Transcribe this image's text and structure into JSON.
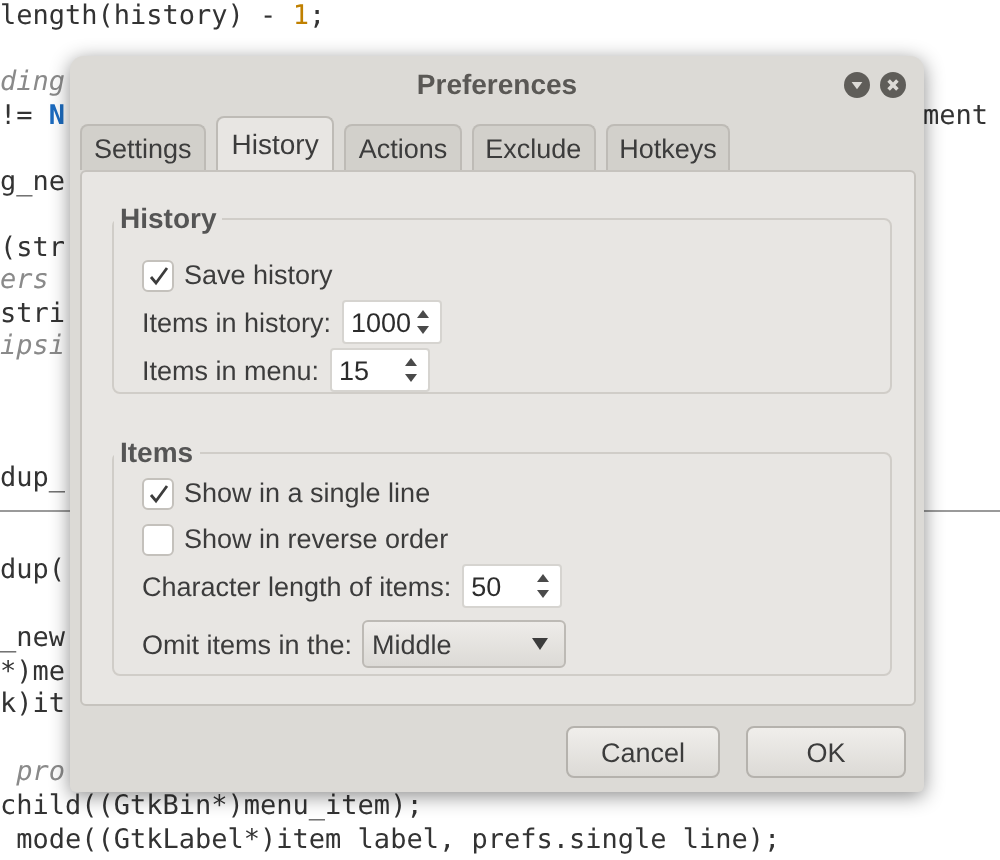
{
  "editor": {
    "panes": [
      {
        "rows": [
          {
            "segments": [
              {
                "kind": "code",
                "text": "length(history) - "
              },
              {
                "kind": "number",
                "text": "1"
              },
              {
                "kind": "code",
                "text": ";"
              }
            ]
          },
          {
            "segments": [
              {
                "kind": "comment",
                "text": "ding"
              }
            ]
          },
          {
            "segments": [
              {
                "kind": "code",
                "text": "!= "
              },
              {
                "kind": "keyword",
                "text": "N"
              }
            ],
            "right": "ment"
          },
          {
            "segments": [
              {
                "kind": "code",
                "text": "g_ne"
              }
            ]
          },
          {
            "segments": [
              {
                "kind": "code",
                "text": "(str"
              }
            ]
          },
          {
            "segments": [
              {
                "kind": "comment",
                "text": "ers"
              }
            ]
          },
          {
            "segments": [
              {
                "kind": "code",
                "text": "stri"
              }
            ]
          },
          {
            "segments": [
              {
                "kind": "comment",
                "text": "ipsi"
              }
            ]
          },
          {
            "segments": [
              {
                "kind": "code",
                "text": "dup_"
              }
            ]
          }
        ]
      },
      {
        "rows": [
          {
            "segments": [
              {
                "kind": "code",
                "text": "dup("
              }
            ]
          },
          {
            "segments": [
              {
                "kind": "code",
                "text": "_new"
              }
            ]
          },
          {
            "segments": [
              {
                "kind": "code",
                "text": "*)me"
              }
            ]
          },
          {
            "segments": [
              {
                "kind": "code",
                "text": "k)it"
              }
            ]
          },
          {
            "segments": [
              {
                "kind": "comment",
                "text": " pro"
              }
            ]
          },
          {
            "segments": [
              {
                "kind": "code",
                "text": "child((GtkBin*)menu_item);"
              }
            ]
          },
          {
            "segments": [
              {
                "kind": "code",
                "text": " mode((GtkLabel*)item label, prefs.single line);"
              }
            ]
          }
        ]
      }
    ]
  },
  "dialog": {
    "title": "Preferences",
    "tabs": [
      {
        "label": "Settings",
        "selected": false
      },
      {
        "label": "History",
        "selected": true
      },
      {
        "label": "Actions",
        "selected": false
      },
      {
        "label": "Exclude",
        "selected": false
      },
      {
        "label": "Hotkeys",
        "selected": false
      }
    ],
    "sections": [
      {
        "title": "History",
        "items": [
          {
            "kind": "checkbox",
            "label": "Save history",
            "checked": true
          },
          {
            "kind": "spin",
            "label": "Items in history:",
            "value": "1000"
          },
          {
            "kind": "spin",
            "label": "Items in menu:",
            "value": "15"
          }
        ]
      },
      {
        "title": "Items",
        "items": [
          {
            "kind": "checkbox",
            "label": "Show in a single line",
            "checked": true
          },
          {
            "kind": "checkbox",
            "label": "Show in reverse order",
            "checked": false
          },
          {
            "kind": "spin",
            "label": "Character length of items:",
            "value": "50"
          },
          {
            "kind": "combo",
            "label": "Omit items in the:",
            "value": "Middle"
          }
        ]
      }
    ],
    "buttons": [
      "Cancel",
      "OK"
    ]
  }
}
